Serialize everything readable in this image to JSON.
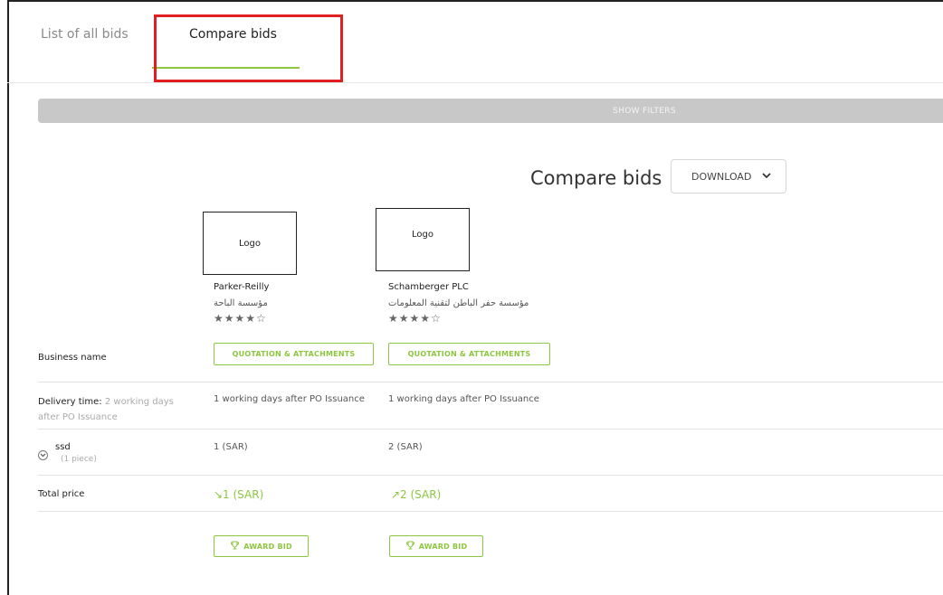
{
  "tabs": [
    {
      "label": "List of all bids",
      "active": false
    },
    {
      "label": "Compare bids",
      "active": true
    }
  ],
  "filters": {
    "label": "SHOW FILTERS"
  },
  "header": {
    "title": "Compare bids",
    "download_label": "DOWNLOAD"
  },
  "bids": [
    {
      "logo_text": "Logo",
      "name": "Parker-Reilly",
      "name_arabic": "مؤسسة الباحة",
      "stars": "★★★★☆",
      "rating": 4,
      "quotation_label": "QUOTATION & ATTACHMENTS",
      "delivery": "1 working days after PO Issuance",
      "item_price": "1 (SAR)",
      "total_price": "↘1 (SAR)",
      "award_label": "AWARD BID"
    },
    {
      "logo_text": "Logo",
      "name": "Schamberger PLC",
      "name_arabic": "مؤسسة حفر الباطن لتقنية المعلومات",
      "stars": "★★★★☆",
      "rating": 4,
      "quotation_label": "QUOTATION & ATTACHMENTS",
      "delivery": "1 working days after PO Issuance",
      "item_price": "2 (SAR)",
      "total_price": "↗2 (SAR)",
      "award_label": "AWARD BID"
    }
  ],
  "rows": {
    "business_name": "Business name",
    "delivery_label": "Delivery time:",
    "delivery_requirement": "2 working days after PO Issuance",
    "item_name": "ssd",
    "item_quantity": "(1 piece)",
    "total_label": "Total price"
  },
  "colors": {
    "accent": "#8dc63f",
    "highlight": "#e02020",
    "filters_bar": "#c8c8c8"
  }
}
